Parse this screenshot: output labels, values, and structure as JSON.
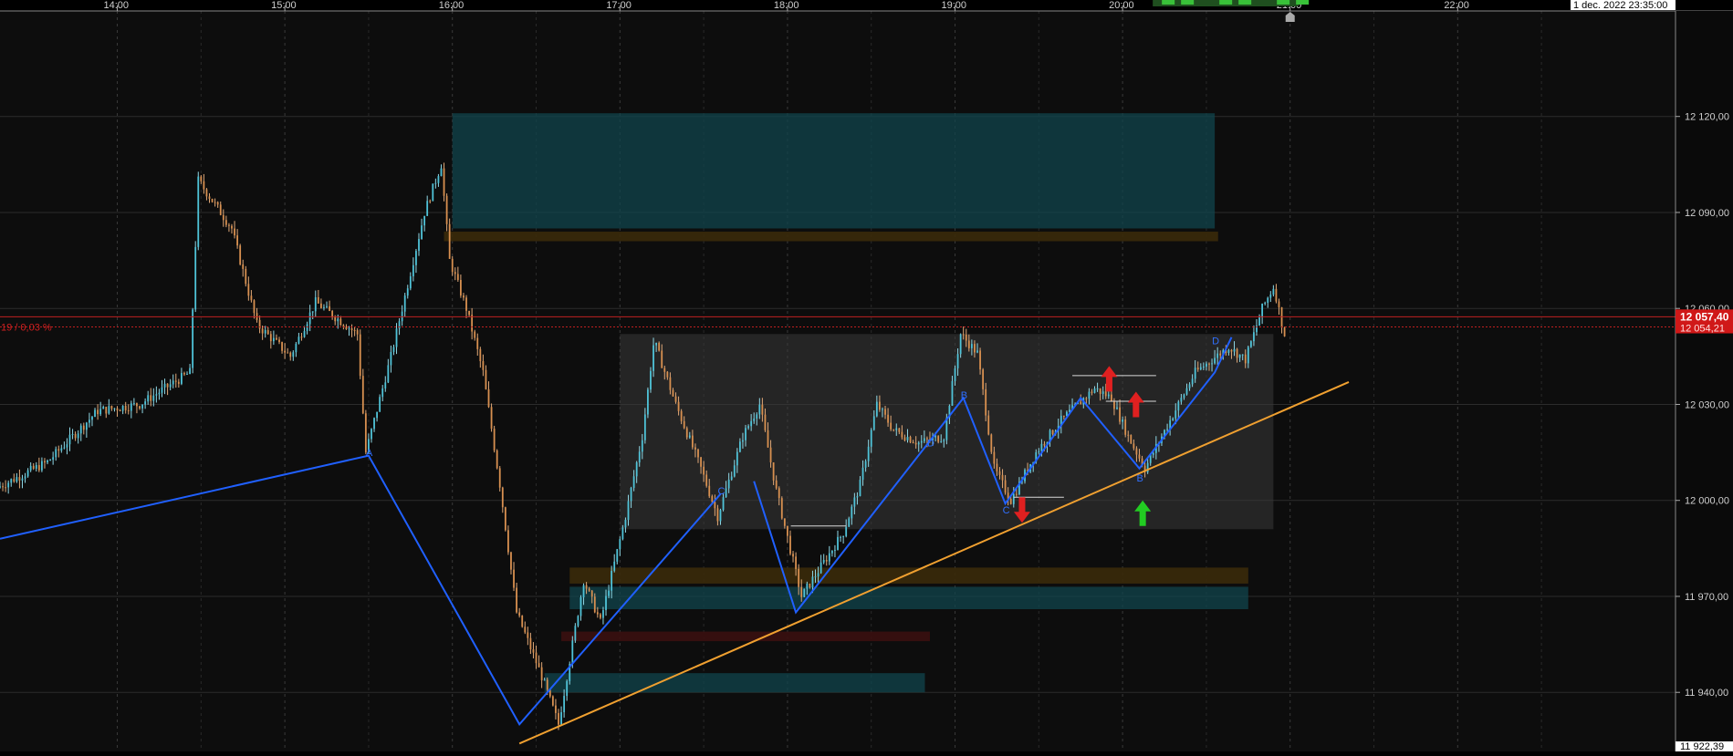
{
  "chart_data": {
    "type": "candlestick",
    "title": "",
    "time_ticks": [
      "14:00",
      "15:00",
      "16:00",
      "17:00",
      "18:00",
      "19:00",
      "20:00",
      "21:00",
      "22:00"
    ],
    "datetime_label": "1 dec. 2022 23:35:00",
    "price_ticks": [
      {
        "label": "12 120,00",
        "value": 12120
      },
      {
        "label": "12 090,00",
        "value": 12090
      },
      {
        "label": "12 060,00",
        "value": 12060
      },
      {
        "label": "12 030,00",
        "value": 12030
      },
      {
        "label": "12 000,00",
        "value": 12000
      },
      {
        "label": "11 970,00",
        "value": 11970
      },
      {
        "label": "11 940,00",
        "value": 11940
      }
    ],
    "ylim": [
      11922.39,
      12145
    ],
    "xlim_hours": [
      13.3,
      23.3
    ],
    "current_price": {
      "value": 12057.4,
      "label": "12 057,40"
    },
    "second_price": {
      "value": 12054.21,
      "label": "12 054,21"
    },
    "bottom_price_label": "11 922,39",
    "change_label": "19 / 0,03 %",
    "key_prices": [
      {
        "t": 13.3,
        "p": 12004
      },
      {
        "t": 13.6,
        "p": 12012
      },
      {
        "t": 13.9,
        "p": 12028
      },
      {
        "t": 14.15,
        "p": 12030
      },
      {
        "t": 14.45,
        "p": 12040
      },
      {
        "t": 14.5,
        "p": 12100
      },
      {
        "t": 14.7,
        "p": 12085
      },
      {
        "t": 14.85,
        "p": 12055
      },
      {
        "t": 15.05,
        "p": 12045
      },
      {
        "t": 15.2,
        "p": 12062
      },
      {
        "t": 15.45,
        "p": 12052
      },
      {
        "t": 15.5,
        "p": 12015
      },
      {
        "t": 15.65,
        "p": 12045
      },
      {
        "t": 15.85,
        "p": 12090
      },
      {
        "t": 15.95,
        "p": 12105
      },
      {
        "t": 16.0,
        "p": 12075
      },
      {
        "t": 16.1,
        "p": 12060
      },
      {
        "t": 16.2,
        "p": 12040
      },
      {
        "t": 16.3,
        "p": 12005
      },
      {
        "t": 16.4,
        "p": 11965
      },
      {
        "t": 16.55,
        "p": 11945
      },
      {
        "t": 16.65,
        "p": 11930
      },
      {
        "t": 16.8,
        "p": 11975
      },
      {
        "t": 16.9,
        "p": 11962
      },
      {
        "t": 17.05,
        "p": 11995
      },
      {
        "t": 17.15,
        "p": 12020
      },
      {
        "t": 17.22,
        "p": 12050
      },
      {
        "t": 17.35,
        "p": 12030
      },
      {
        "t": 17.5,
        "p": 12010
      },
      {
        "t": 17.6,
        "p": 11995
      },
      {
        "t": 17.75,
        "p": 12020
      },
      {
        "t": 17.85,
        "p": 12030
      },
      {
        "t": 17.95,
        "p": 12003
      },
      {
        "t": 18.1,
        "p": 11970
      },
      {
        "t": 18.2,
        "p": 11978
      },
      {
        "t": 18.35,
        "p": 11990
      },
      {
        "t": 18.45,
        "p": 12005
      },
      {
        "t": 18.55,
        "p": 12030
      },
      {
        "t": 18.65,
        "p": 12022
      },
      {
        "t": 18.8,
        "p": 12018
      },
      {
        "t": 18.95,
        "p": 12020
      },
      {
        "t": 19.05,
        "p": 12052
      },
      {
        "t": 19.15,
        "p": 12046
      },
      {
        "t": 19.25,
        "p": 12010
      },
      {
        "t": 19.35,
        "p": 12000
      },
      {
        "t": 19.5,
        "p": 12015
      },
      {
        "t": 19.65,
        "p": 12025
      },
      {
        "t": 19.85,
        "p": 12035
      },
      {
        "t": 19.95,
        "p": 12032
      },
      {
        "t": 20.05,
        "p": 12020
      },
      {
        "t": 20.15,
        "p": 12010
      },
      {
        "t": 20.25,
        "p": 12020
      },
      {
        "t": 20.45,
        "p": 12040
      },
      {
        "t": 20.65,
        "p": 12048
      },
      {
        "t": 20.75,
        "p": 12044
      },
      {
        "t": 20.85,
        "p": 12060
      },
      {
        "t": 20.92,
        "p": 12067
      },
      {
        "t": 20.98,
        "p": 12052
      }
    ],
    "zones": [
      {
        "t0": 16.0,
        "t1": 20.55,
        "p0": 12085,
        "p1": 12121,
        "color": "#10444c",
        "opacity": 0.75
      },
      {
        "t0": 15.95,
        "t1": 20.57,
        "p0": 12081,
        "p1": 12084,
        "color": "#3a2a0a",
        "opacity": 0.9
      },
      {
        "t0": 17.0,
        "t1": 20.9,
        "p0": 11991,
        "p1": 12052,
        "color": "#3a3a3a",
        "opacity": 0.55
      },
      {
        "t0": 16.7,
        "t1": 20.75,
        "p0": 11974,
        "p1": 11979,
        "color": "#3a2a0a",
        "opacity": 0.9
      },
      {
        "t0": 16.7,
        "t1": 20.75,
        "p0": 11966,
        "p1": 11973,
        "color": "#10444c",
        "opacity": 0.75
      },
      {
        "t0": 16.65,
        "t1": 18.85,
        "p0": 11956,
        "p1": 11959,
        "color": "#3a1010",
        "opacity": 0.9
      },
      {
        "t0": 16.55,
        "t1": 18.82,
        "p0": 11940,
        "p1": 11946,
        "color": "#10444c",
        "opacity": 0.75
      }
    ],
    "wave_lines": [
      [
        {
          "t": 13.3,
          "p": 11988
        },
        {
          "t": 15.5,
          "p": 12014
        },
        {
          "t": 16.4,
          "p": 11930
        },
        {
          "t": 17.6,
          "p": 12002
        }
      ],
      [
        {
          "t": 17.8,
          "p": 12006
        },
        {
          "t": 18.05,
          "p": 11965
        },
        {
          "t": 19.05,
          "p": 12032
        },
        {
          "t": 19.3,
          "p": 11999
        },
        {
          "t": 19.75,
          "p": 12032
        },
        {
          "t": 20.1,
          "p": 12010
        },
        {
          "t": 20.55,
          "p": 12040
        },
        {
          "t": 20.65,
          "p": 12051
        }
      ]
    ],
    "wave_labels": [
      {
        "t": 15.5,
        "p": 12015,
        "text": "A"
      },
      {
        "t": 17.6,
        "p": 12003,
        "text": "C"
      },
      {
        "t": 19.05,
        "p": 12033,
        "text": "B"
      },
      {
        "t": 19.3,
        "p": 11997,
        "text": "C"
      },
      {
        "t": 20.1,
        "p": 12007,
        "text": "B"
      },
      {
        "t": 18.85,
        "p": 12018,
        "text": "D"
      },
      {
        "t": 20.55,
        "p": 12050,
        "text": "D"
      }
    ],
    "trendline": {
      "t0": 16.4,
      "p0": 11924,
      "t1": 21.35,
      "p1": 12037,
      "color": "#f0a030"
    },
    "horizontal_marks": [
      {
        "t0": 18.02,
        "t1": 18.35,
        "p": 11992
      },
      {
        "t0": 19.35,
        "t1": 19.65,
        "p": 12001
      },
      {
        "t0": 19.7,
        "t1": 20.2,
        "p": 12039
      },
      {
        "t0": 19.9,
        "t1": 20.2,
        "p": 12031
      }
    ],
    "signals": [
      {
        "t": 19.4,
        "p": 11997,
        "dir": "down",
        "color": "#e02020"
      },
      {
        "t": 19.92,
        "p": 12038,
        "dir": "up",
        "color": "#e02020"
      },
      {
        "t": 20.08,
        "p": 12030,
        "dir": "up",
        "color": "#e02020"
      },
      {
        "t": 20.12,
        "p": 11996,
        "dir": "up",
        "color": "#22cc22"
      }
    ]
  }
}
